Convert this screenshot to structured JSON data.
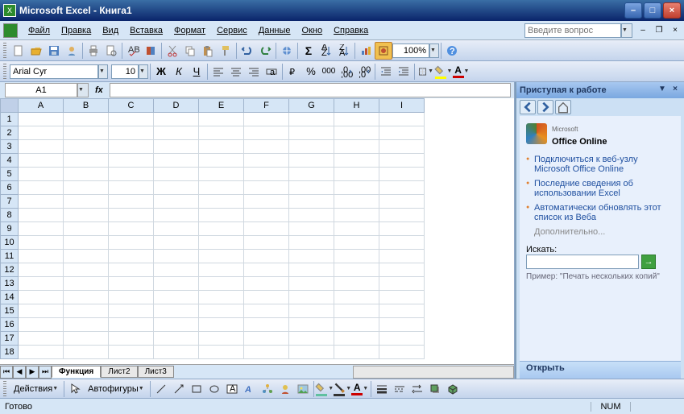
{
  "title": "Microsoft Excel - Книга1",
  "menu": {
    "file": "Файл",
    "edit": "Правка",
    "view": "Вид",
    "insert": "Вставка",
    "format": "Формат",
    "tools": "Сервис",
    "data": "Данные",
    "window": "Окно",
    "help": "Справка"
  },
  "helpPlaceholder": "Введите вопрос",
  "format": {
    "font": "Arial Cyr",
    "size": "10"
  },
  "zoom": "100%",
  "nameBox": "A1",
  "columns": [
    "A",
    "B",
    "C",
    "D",
    "E",
    "F",
    "G",
    "H",
    "I"
  ],
  "rows": [
    "1",
    "2",
    "3",
    "4",
    "5",
    "6",
    "7",
    "8",
    "9",
    "10",
    "11",
    "12",
    "13",
    "14",
    "15",
    "16",
    "17",
    "18"
  ],
  "tabs": [
    "Функция",
    "Лист2",
    "Лист3"
  ],
  "taskpane": {
    "title": "Приступая к работе",
    "officeBrand": "Office Online",
    "officeBrandPrefix": "Microsoft",
    "links": [
      "Подключиться к веб-узлу Microsoft Office Online",
      "Последние сведения об использовании Excel",
      "Автоматически обновлять этот список из Веба"
    ],
    "more": "Дополнительно...",
    "searchLabel": "Искать:",
    "example": "Пример: \"Печать нескольких копий\"",
    "open": "Открыть"
  },
  "drawbar": {
    "actions": "Действия",
    "autoshapes": "Автофигуры"
  },
  "status": {
    "ready": "Готово",
    "num": "NUM"
  }
}
